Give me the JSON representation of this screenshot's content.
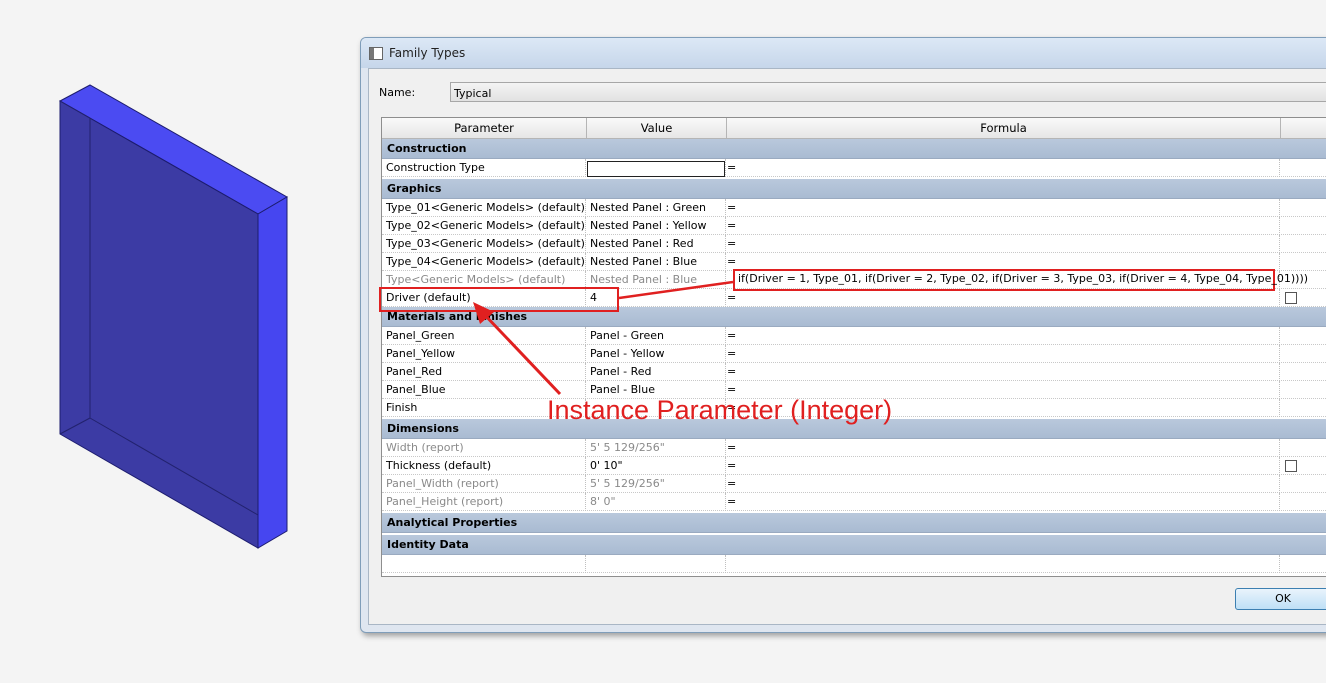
{
  "dialog": {
    "title": "Family Types",
    "name_label": "Name:",
    "name_value": "Typical",
    "ok_label": "OK"
  },
  "table": {
    "columns": [
      "Parameter",
      "Value",
      "Formula",
      ""
    ],
    "groups": {
      "construction": "Construction",
      "graphics": "Graphics",
      "materials": "Materials and Finishes",
      "dimensions": "Dimensions",
      "analytical": "Analytical Properties",
      "identity": "Identity Data"
    },
    "rows": {
      "construction_type": {
        "param": "Construction Type",
        "value": "",
        "formula": "="
      },
      "type01": {
        "param": "Type_01<Generic Models> (default)",
        "value": "Nested Panel : Green",
        "formula": "="
      },
      "type02": {
        "param": "Type_02<Generic Models> (default)",
        "value": "Nested Panel : Yellow",
        "formula": "="
      },
      "type03": {
        "param": "Type_03<Generic Models> (default)",
        "value": "Nested Panel : Red",
        "formula": "="
      },
      "type04": {
        "param": "Type_04<Generic Models> (default)",
        "value": "Nested Panel : Blue",
        "formula": "="
      },
      "type": {
        "param": "Type<Generic Models> (default)",
        "value": "Nested Panel : Blue",
        "formula": "if(Driver = 1, Type_01, if(Driver = 2, Type_02, if(Driver = 3, Type_03, if(Driver = 4, Type_04, Type_01))))"
      },
      "driver": {
        "param": "Driver (default)",
        "value": "4",
        "formula": "="
      },
      "panel_green": {
        "param": "Panel_Green",
        "value": "Panel - Green",
        "formula": "="
      },
      "panel_yellow": {
        "param": "Panel_Yellow",
        "value": "Panel - Yellow",
        "formula": "="
      },
      "panel_red": {
        "param": "Panel_Red",
        "value": "Panel - Red",
        "formula": "="
      },
      "panel_blue": {
        "param": "Panel_Blue",
        "value": "Panel - Blue",
        "formula": "="
      },
      "finish": {
        "param": "Finish",
        "value": "",
        "formula": "="
      },
      "width": {
        "param": "Width (report)",
        "value": "5'  5 129/256\"",
        "formula": "="
      },
      "thickness": {
        "param": "Thickness (default)",
        "value": "0'  10\"",
        "formula": "="
      },
      "panel_width": {
        "param": "Panel_Width (report)",
        "value": "5'  5 129/256\"",
        "formula": "="
      },
      "panel_height": {
        "param": "Panel_Height (report)",
        "value": "8'  0\"",
        "formula": "="
      }
    }
  },
  "annotation": {
    "text": "Instance Parameter (Integer)",
    "color": "#e02020"
  },
  "colors": {
    "panel_face": "#3a3a9e",
    "panel_edge": "#4a4af0",
    "group_header": "#b2c3d9"
  }
}
